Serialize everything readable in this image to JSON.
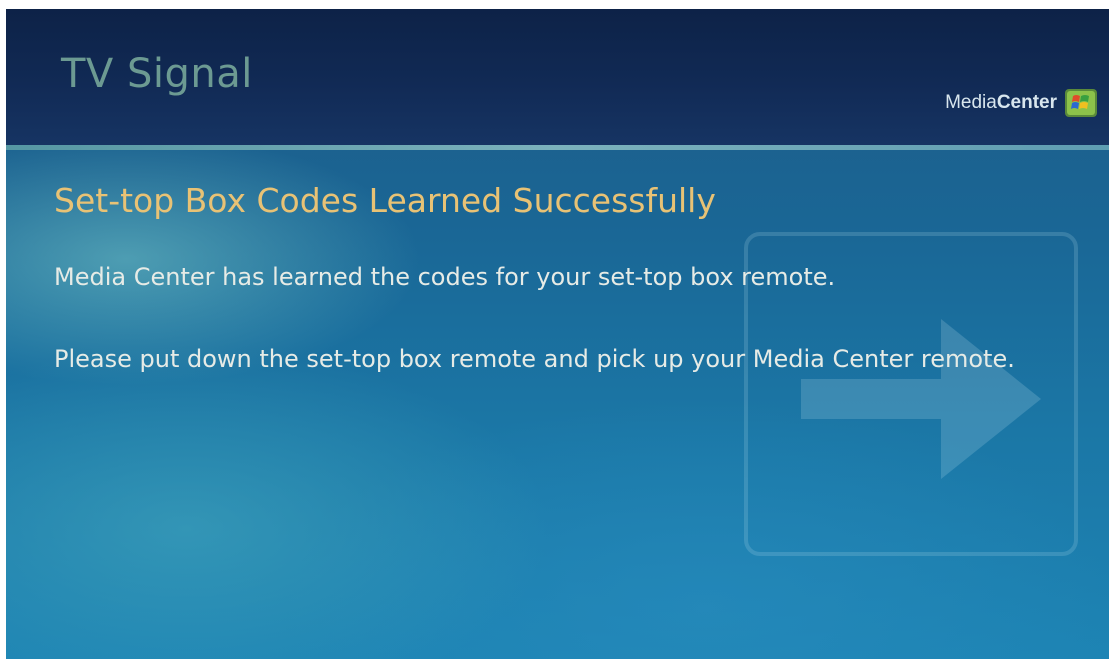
{
  "header": {
    "title": "TV Signal",
    "brand_prefix": "Media",
    "brand_suffix": "Center",
    "logo_icon": "windows-flag-icon"
  },
  "dialog": {
    "title": "Set-top Box Codes Learned Successfully",
    "paragraphs": [
      "Media Center has learned the codes for your set-top box remote.",
      "Please put down the set-top box remote and pick up your Media Center remote."
    ]
  },
  "colors": {
    "header_bg": "#0d2247",
    "header_title": "#6c9a92",
    "dialog_title": "#e8c275",
    "body_text": "#e6ebe6",
    "screen_bg": "#1b77a6"
  }
}
